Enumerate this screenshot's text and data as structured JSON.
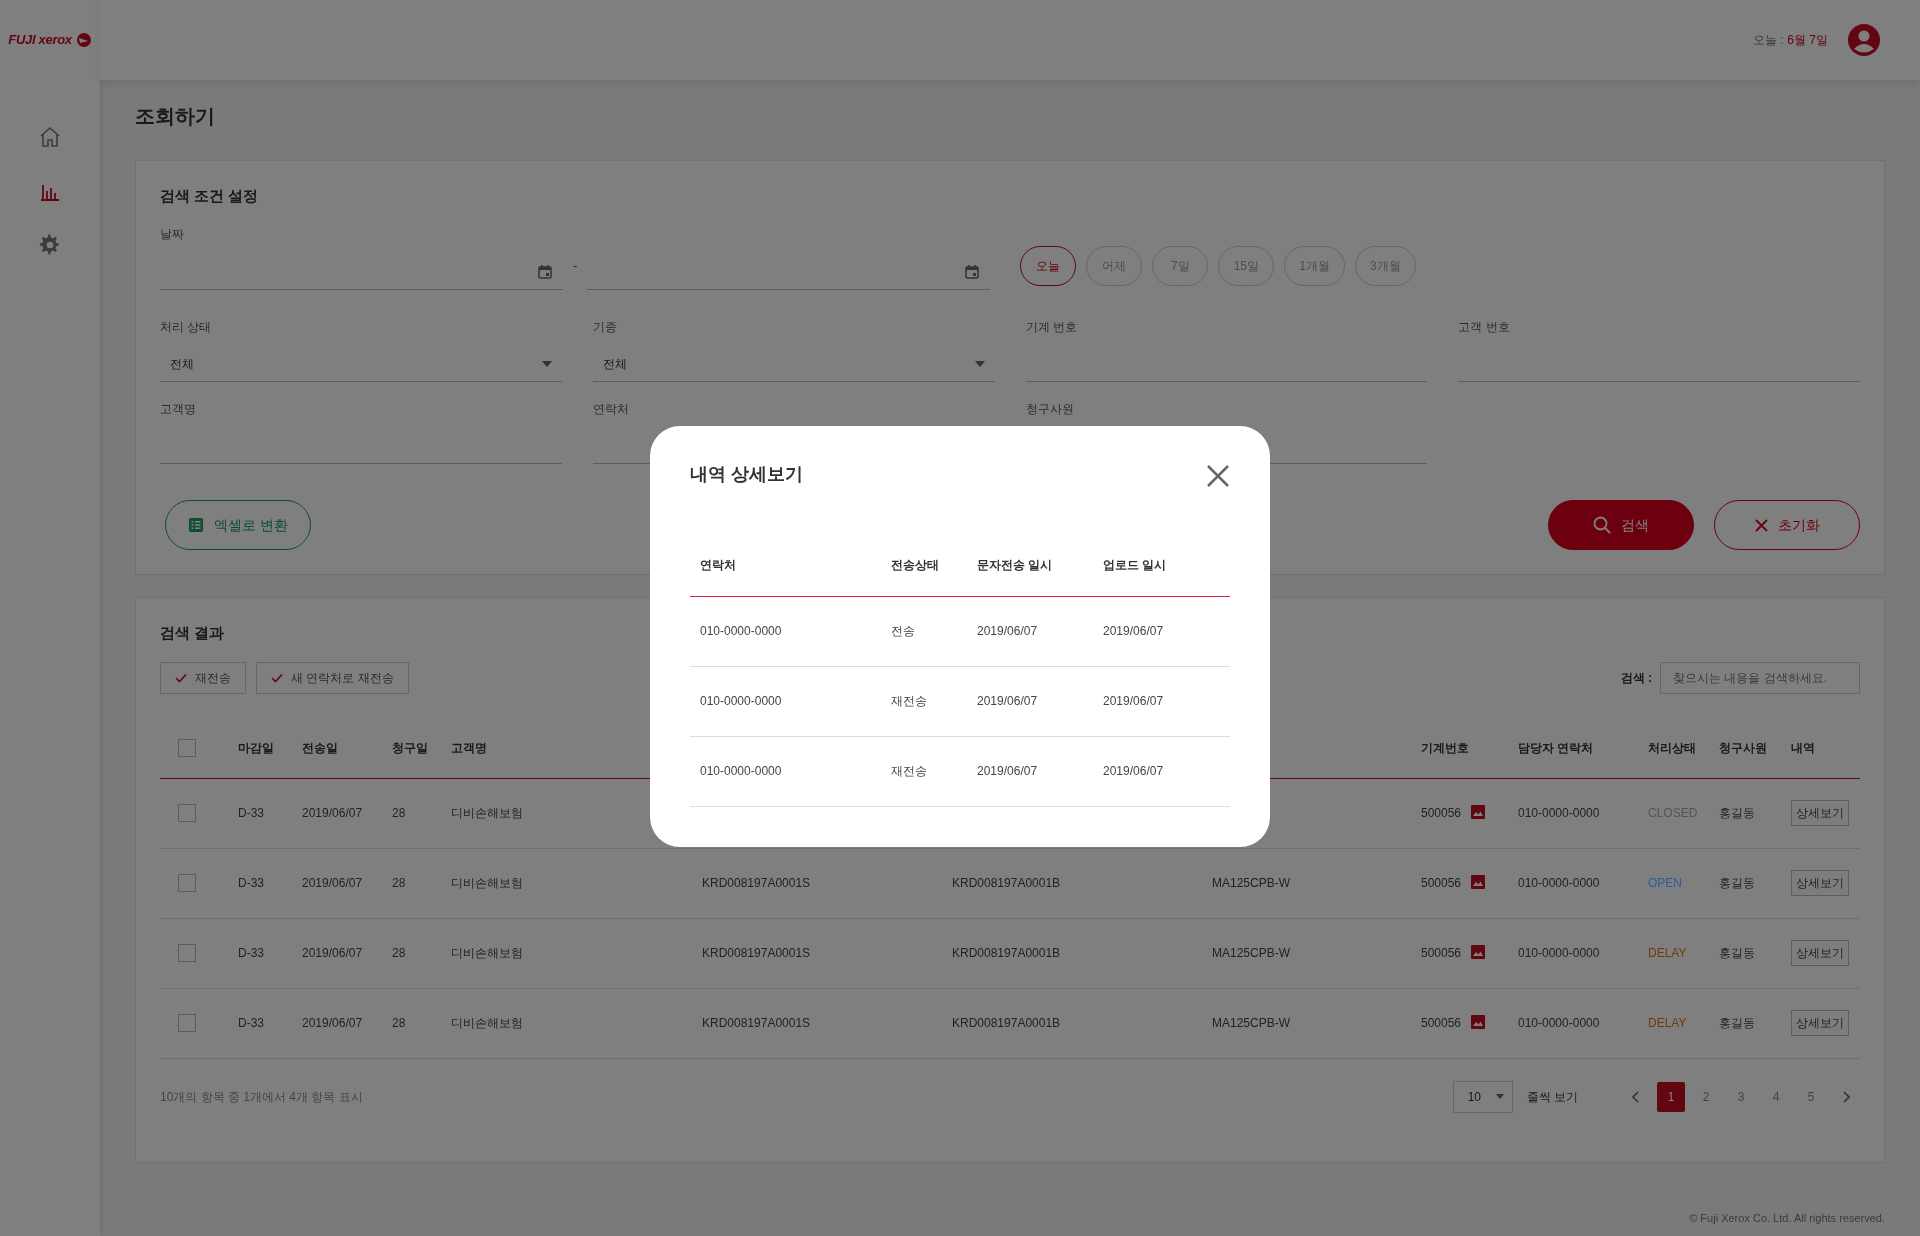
{
  "logo": "FUJI xerox",
  "sidebar": {
    "items": [
      {
        "selected": false
      },
      {
        "selected": true
      },
      {
        "selected": false
      }
    ]
  },
  "header": {
    "today_label": "오늘 :",
    "today_value": "6월 7일"
  },
  "page_title": "조회하기",
  "search_panel": {
    "title": "검색 조건 설정",
    "date_label": "날짜",
    "date_separator": "-",
    "periods": [
      {
        "label": "오늘",
        "selected": true
      },
      {
        "label": "어제",
        "selected": false
      },
      {
        "label": "7일",
        "selected": false
      },
      {
        "label": "15일",
        "selected": false
      },
      {
        "label": "1개월",
        "selected": false
      },
      {
        "label": "3개월",
        "selected": false
      }
    ],
    "fields": [
      {
        "kind": "select",
        "label": "처리 상태",
        "value": "전체"
      },
      {
        "kind": "select",
        "label": "기종",
        "value": "전체"
      },
      {
        "kind": "input",
        "label": "기계 번호"
      },
      {
        "kind": "input",
        "label": "고객 번호"
      },
      {
        "kind": "input",
        "label": "고객명"
      },
      {
        "kind": "input",
        "label": "연락처"
      },
      {
        "kind": "input",
        "label": "청구사원"
      }
    ],
    "excel_button": "엑셀로 변환",
    "search_button": "검색",
    "reset_button": "초기화"
  },
  "results": {
    "title": "검색 결과",
    "actions": [
      "재전송",
      "새 연락처로 재전송"
    ],
    "search_label": "검색 :",
    "search_placeholder": "찾으시는 내용을 검색하세요.",
    "select_all": {
      "checked": false
    },
    "columns": {
      "deadline": "마감일",
      "sent": "전송일",
      "claim_day": "청구일",
      "customer": "고객명",
      "machine_no": "기계번호",
      "contact": "담당자 연락처",
      "status": "처리상태",
      "employee": "청구사원",
      "detail": "내역"
    },
    "rows": [
      {
        "checked": false,
        "deadline": "D-33",
        "sent": "2019/06/07",
        "claim_day": "28",
        "customer": "디비손해보험",
        "machine_no": "500056",
        "contact": "010-0000-0000",
        "status": "CLOSED",
        "color": "#555555",
        "employee": "홍길동",
        "detail": "상세보기"
      },
      {
        "checked": false,
        "deadline": "D-33",
        "sent": "2019/06/07",
        "claim_day": "28",
        "customer": "디비손해보험",
        "column_5": "KRD008197A0001S",
        "column_6": "KRD008197A0001B",
        "column_7": "MA125CPB-W",
        "machine_no": "500056",
        "contact": "010-0000-0000",
        "status": "OPEN",
        "color": "#2f5aa0",
        "employee": "홍길동",
        "detail": "상세보기"
      },
      {
        "checked": false,
        "deadline": "D-33",
        "sent": "2019/06/07",
        "claim_day": "28",
        "customer": "디비손해보험",
        "column_5": "KRD008197A0001S",
        "column_6": "KRD008197A0001B",
        "column_7": "MA125CPB-W",
        "machine_no": "500056",
        "contact": "010-0000-0000",
        "status": "DELAY",
        "color": "#6e3c08",
        "employee": "홍길동",
        "detail": "상세보기"
      },
      {
        "checked": false,
        "deadline": "D-33",
        "sent": "2019/06/07",
        "claim_day": "28",
        "customer": "디비손해보험",
        "column_5": "KRD008197A0001S",
        "column_6": "KRD008197A0001B",
        "column_7": "MA125CPB-W",
        "machine_no": "500056",
        "contact": "010-0000-0000",
        "status": "DELAY",
        "color": "#6e3c08",
        "employee": "홍길동",
        "detail": "상세보기"
      }
    ],
    "summary": "10개의 항목 중 1개에서 4개 항목 표시",
    "page_size": "10",
    "page_size_label": "줄씩 보기",
    "pages": [
      {
        "label": "1",
        "selected": true
      },
      {
        "label": "2",
        "selected": false
      },
      {
        "label": "3",
        "selected": false
      },
      {
        "label": "4",
        "selected": false
      },
      {
        "label": "5",
        "selected": false
      }
    ]
  },
  "footer": "© Fuji Xerox Co. Ltd. All rights reserved.",
  "modal": {
    "title": "내역 상세보기",
    "columns": [
      "연락처",
      "전송상태",
      "문자전송 일시",
      "업로드 일시"
    ],
    "rows": [
      [
        "010-0000-0000",
        "전송",
        "2019/06/07",
        "2019/06/07"
      ],
      [
        "010-0000-0000",
        "재전송",
        "2019/06/07",
        "2019/06/07"
      ],
      [
        "010-0000-0000",
        "재전송",
        "2019/06/07",
        "2019/06/07"
      ]
    ]
  }
}
